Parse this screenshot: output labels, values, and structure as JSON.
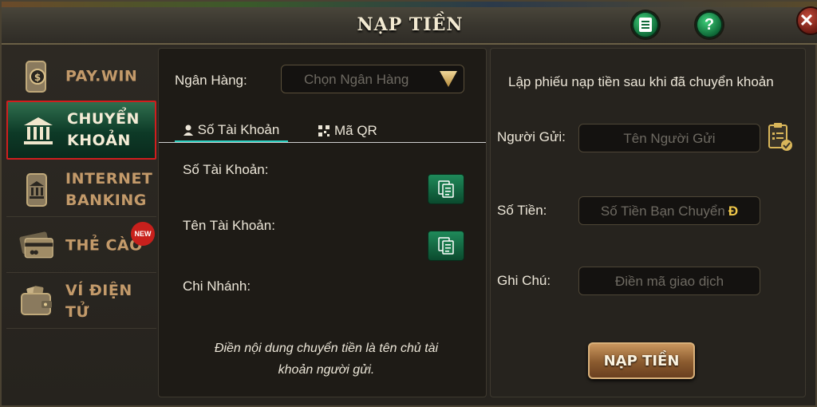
{
  "header": {
    "title": "NẠP TIỀN",
    "list_icon": "list-icon",
    "help_label": "?",
    "close_label": "✕"
  },
  "sidebar": {
    "items": [
      {
        "label": "PAY.WIN",
        "icon": "phone-dollar-icon"
      },
      {
        "label": "CHUYỂN\nKHOẢN",
        "icon": "bank-icon"
      },
      {
        "label": "INTERNET\nBANKING",
        "icon": "mobile-bank-icon"
      },
      {
        "label": "THẺ CÀO",
        "icon": "card-icon",
        "badge": "NEW"
      },
      {
        "label": "VÍ ĐIỆN TỬ",
        "icon": "wallet-icon"
      }
    ]
  },
  "middle": {
    "bank_label": "Ngân Hàng:",
    "bank_select_placeholder": "Chọn Ngân Hàng",
    "tabs": [
      {
        "label": "Số Tài Khoản",
        "icon": "user-icon"
      },
      {
        "label": "Mã QR",
        "icon": "qr-icon"
      }
    ],
    "account_number_label": "Số Tài Khoản:",
    "account_name_label": "Tên Tài Khoản:",
    "branch_label": "Chi Nhánh:",
    "note": "Điền nội dung chuyển tiền là tên chủ tài khoản người gửi."
  },
  "right": {
    "title": "Lập phiếu nạp tiền sau khi đã chuyển khoản",
    "sender_label": "Người Gửi:",
    "sender_placeholder": "Tên Người Gửi",
    "amount_label": "Số Tiền:",
    "amount_placeholder": "Số Tiền Bạn Chuyển",
    "currency_symbol": "Đ",
    "memo_label": "Ghi Chú:",
    "memo_placeholder": "Điền mã giao dịch",
    "submit_label": "NẠP TIỀN"
  },
  "colors": {
    "accent_green": "#0f6a38",
    "active_tab_underline": "#2bd0c0",
    "sidebar_label": "#c39a6a",
    "active_border": "#d01e1e"
  }
}
